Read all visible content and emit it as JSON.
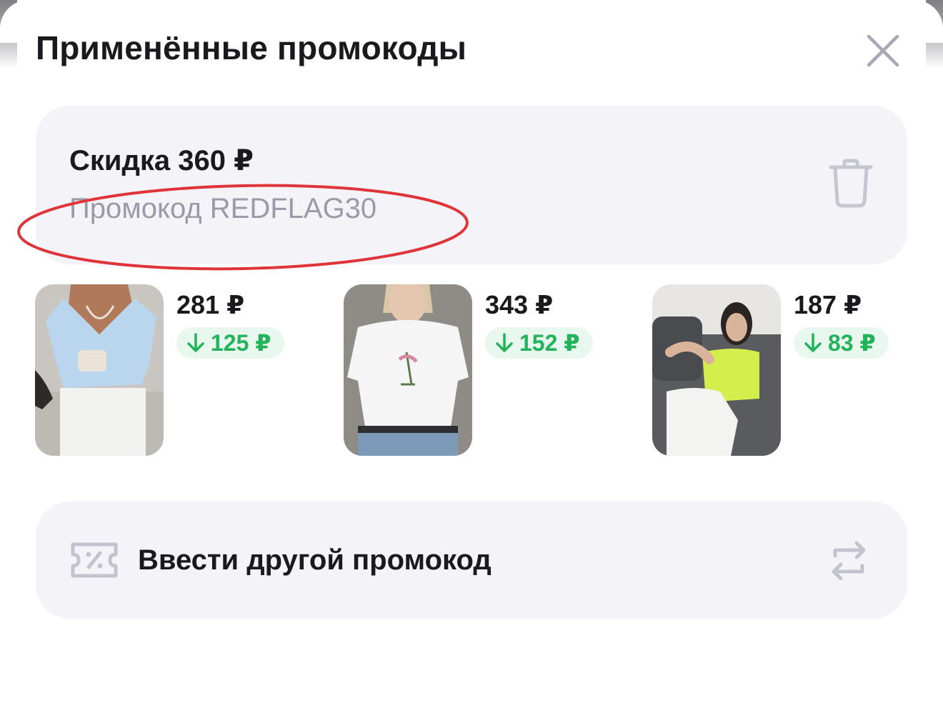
{
  "header": {
    "title": "Применённые промокоды",
    "close_icon": "close-icon"
  },
  "promo": {
    "discount": "Скидка 360 ₽",
    "code": "Промокод REDFLAG30",
    "delete_icon": "trash-icon",
    "highlight_color": "#e0343b"
  },
  "products": [
    {
      "price": "281 ₽",
      "discount": "125 ₽",
      "image": "woman-light-blue-crop-top-photo"
    },
    {
      "price": "343 ₽",
      "discount": "152 ₽",
      "image": "woman-white-tshirt-print-photo"
    },
    {
      "price": "187 ₽",
      "discount": "83 ₽",
      "image": "woman-lime-tank-top-sofa-photo"
    }
  ],
  "other_promo": {
    "label": "Ввести другой промокод",
    "icon": "coupon-icon",
    "action_icon": "swap-icon"
  },
  "colors": {
    "accent_green": "#23b35a",
    "card_bg": "#f4f4f8",
    "secondary_text": "#9a9aa8"
  }
}
